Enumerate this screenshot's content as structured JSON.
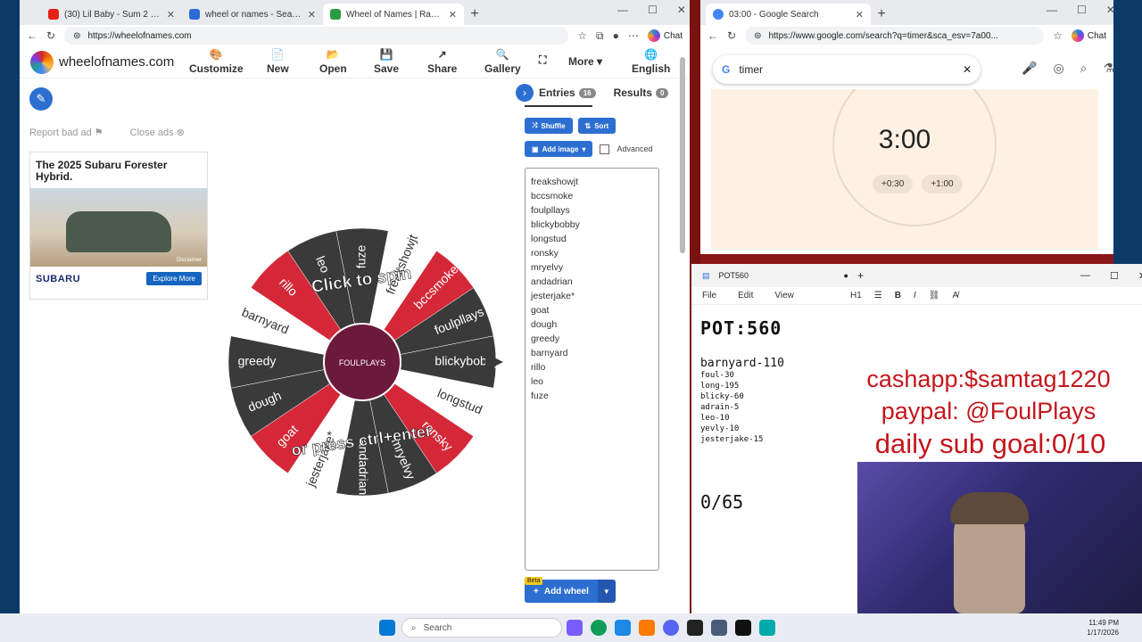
{
  "left_browser": {
    "tabs": [
      {
        "label": "(30) Lil Baby - Sum 2 Prove (O",
        "color": "#e62117"
      },
      {
        "label": "wheel or names - Search",
        "color": "#2b6cd6"
      },
      {
        "label": "Wheel of Names | Random name p",
        "color": "#2b9d43"
      }
    ],
    "url": "https://wheelofnames.com",
    "chat_label": "Chat"
  },
  "site": {
    "brand": "wheelofnames.com",
    "nav": [
      {
        "icon": "🎨",
        "label": "Customize"
      },
      {
        "icon": "📄",
        "label": "New"
      },
      {
        "icon": "📂",
        "label": "Open"
      },
      {
        "icon": "💾",
        "label": "Save"
      },
      {
        "icon": "↗",
        "label": "Share"
      },
      {
        "icon": "🔍",
        "label": "Gallery"
      },
      {
        "icon": "⛶",
        "label": ""
      },
      {
        "icon": "",
        "label": "More ▾"
      },
      {
        "icon": "🌐",
        "label": "English"
      }
    ],
    "report_bad_ad": "Report bad ad",
    "close_ads": "Close ads"
  },
  "ad": {
    "headline": "The 2025 Subaru Forester Hybrid.",
    "disclaimer": "Disclaimer",
    "brand": "SUBARU",
    "cta": "Explore More"
  },
  "wheel": {
    "center_logo_text": "FOULPLAYS",
    "click_text": "Click to spin",
    "press_text": "or press ctrl+enter",
    "slices": [
      "blickybobby",
      "longstud",
      "ronsky",
      "mryelvy",
      "andadrian",
      "jesterjake*",
      "goat",
      "dough",
      "greedy",
      "barnyard",
      "rillo",
      "leo",
      "fuze",
      "freakshowjt",
      "bccsmoke",
      "foulpllays"
    ],
    "colors": [
      "#3a3a3a",
      "#ffffff",
      "#d42838",
      "#3a3a3a"
    ]
  },
  "panel": {
    "entries_tab": "Entries",
    "entries_count": "16",
    "results_tab": "Results",
    "results_count": "0",
    "shuffle": "Shuffle",
    "sort": "Sort",
    "add_image": "Add image",
    "advanced": "Advanced",
    "entries": [
      "freakshowjt",
      "bccsmoke",
      "foulpllays",
      "blickybobby",
      "longstud",
      "ronsky",
      "mryelvy",
      "andadrian",
      "jesterjake*",
      "goat",
      "dough",
      "greedy",
      "barnyard",
      "rillo",
      "leo",
      "fuze"
    ],
    "beta": "Beta",
    "add_wheel": "Add wheel"
  },
  "right_browser": {
    "tab": "03:00 - Google Search",
    "url": "https://www.google.com/search?q=timer&sca_esv=7a00...",
    "chat_label": "Chat",
    "query": "timer",
    "timer": "3:00",
    "add30": "+0:30",
    "add100": "+1:00"
  },
  "notepad": {
    "tab": "POT560",
    "menu": [
      "File",
      "Edit",
      "View"
    ],
    "heading_select": "H1",
    "title": "POT:560",
    "subtitle": "barnyard-110",
    "lines": [
      "foul-30",
      "long-195",
      "blicky-60",
      "adrain-5",
      "leo-10",
      "yevly-10",
      "jesterjake-15"
    ],
    "count": "0/65"
  },
  "overlay": {
    "cashapp": "cashapp:$samtag1220",
    "paypal": "paypal: @FoulPlays",
    "goal": "daily sub goal:0/10"
  },
  "taskbar": {
    "search": "Search",
    "time": "11:49 PM",
    "date": "1/17/2026"
  }
}
